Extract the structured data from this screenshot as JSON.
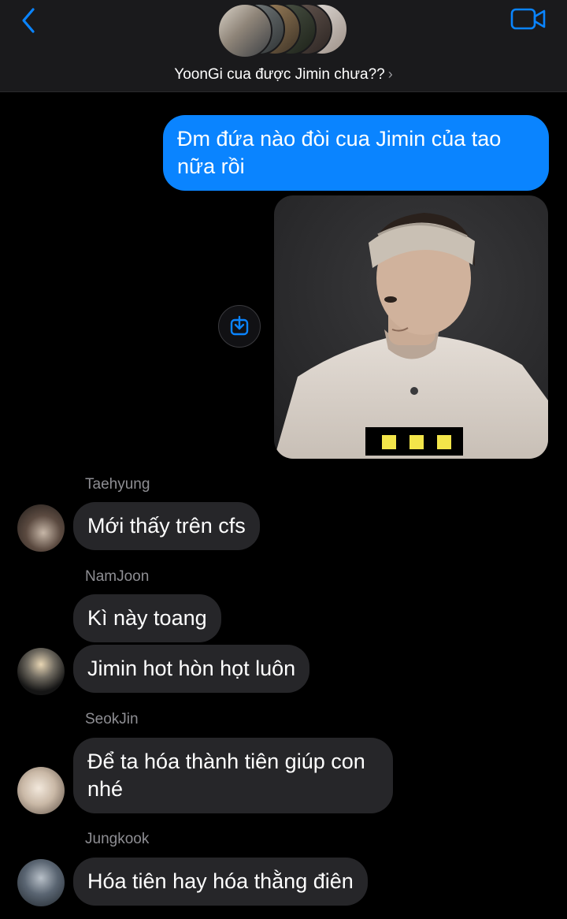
{
  "header": {
    "title": "YoonGi cua được Jimin chưa??",
    "title_chevron": "›",
    "back_icon": "chevron-left-icon",
    "video_icon": "video-camera-icon",
    "accent_color": "#0a84ff"
  },
  "messages": {
    "m1": "Đm đứa nào đòi cua Jimin của tao nữa rồi",
    "m2": "Mới thấy trên cfs",
    "m3": "Kì này toang",
    "m4": "Jimin hot hòn họt luôn",
    "m5": "Để ta hóa thành tiên giúp con nhé",
    "m6": "Hóa tiên hay hóa thằng điên"
  },
  "senders": {
    "s1": "Taehyung",
    "s2": "NamJoon",
    "s3": "SeokJin",
    "s4": "Jungkook"
  },
  "colors": {
    "outgoing_bubble": "#0a84ff",
    "incoming_bubble": "#262629",
    "background": "#000000",
    "header": "#1a1a1c"
  }
}
